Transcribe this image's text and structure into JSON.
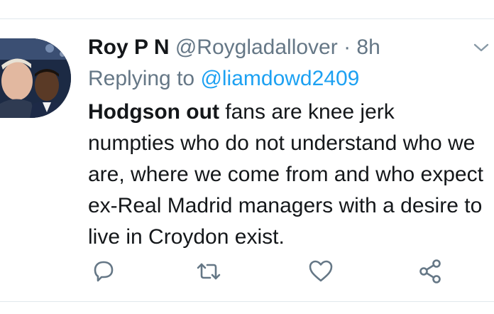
{
  "tweet": {
    "display_name": "Roy P N",
    "handle": "@Roygladallover",
    "separator": "·",
    "time": "8h",
    "replying_prefix": "Replying to",
    "replying_to": "@liamdowd2409",
    "text_bold": "Hodgson out",
    "text_rest": " fans are knee jerk numpties who do not understand who we are, where we come from and who expect ex-Real Madrid managers with a desire to live in Croydon exist."
  },
  "icons": {
    "more": "chevron-down-icon",
    "reply": "reply-icon",
    "retweet": "retweet-icon",
    "like": "heart-icon",
    "share": "share-icon"
  },
  "colors": {
    "text": "#14171a",
    "secondary": "#657786",
    "link": "#1da1f2",
    "divider": "#e1e8ed"
  }
}
